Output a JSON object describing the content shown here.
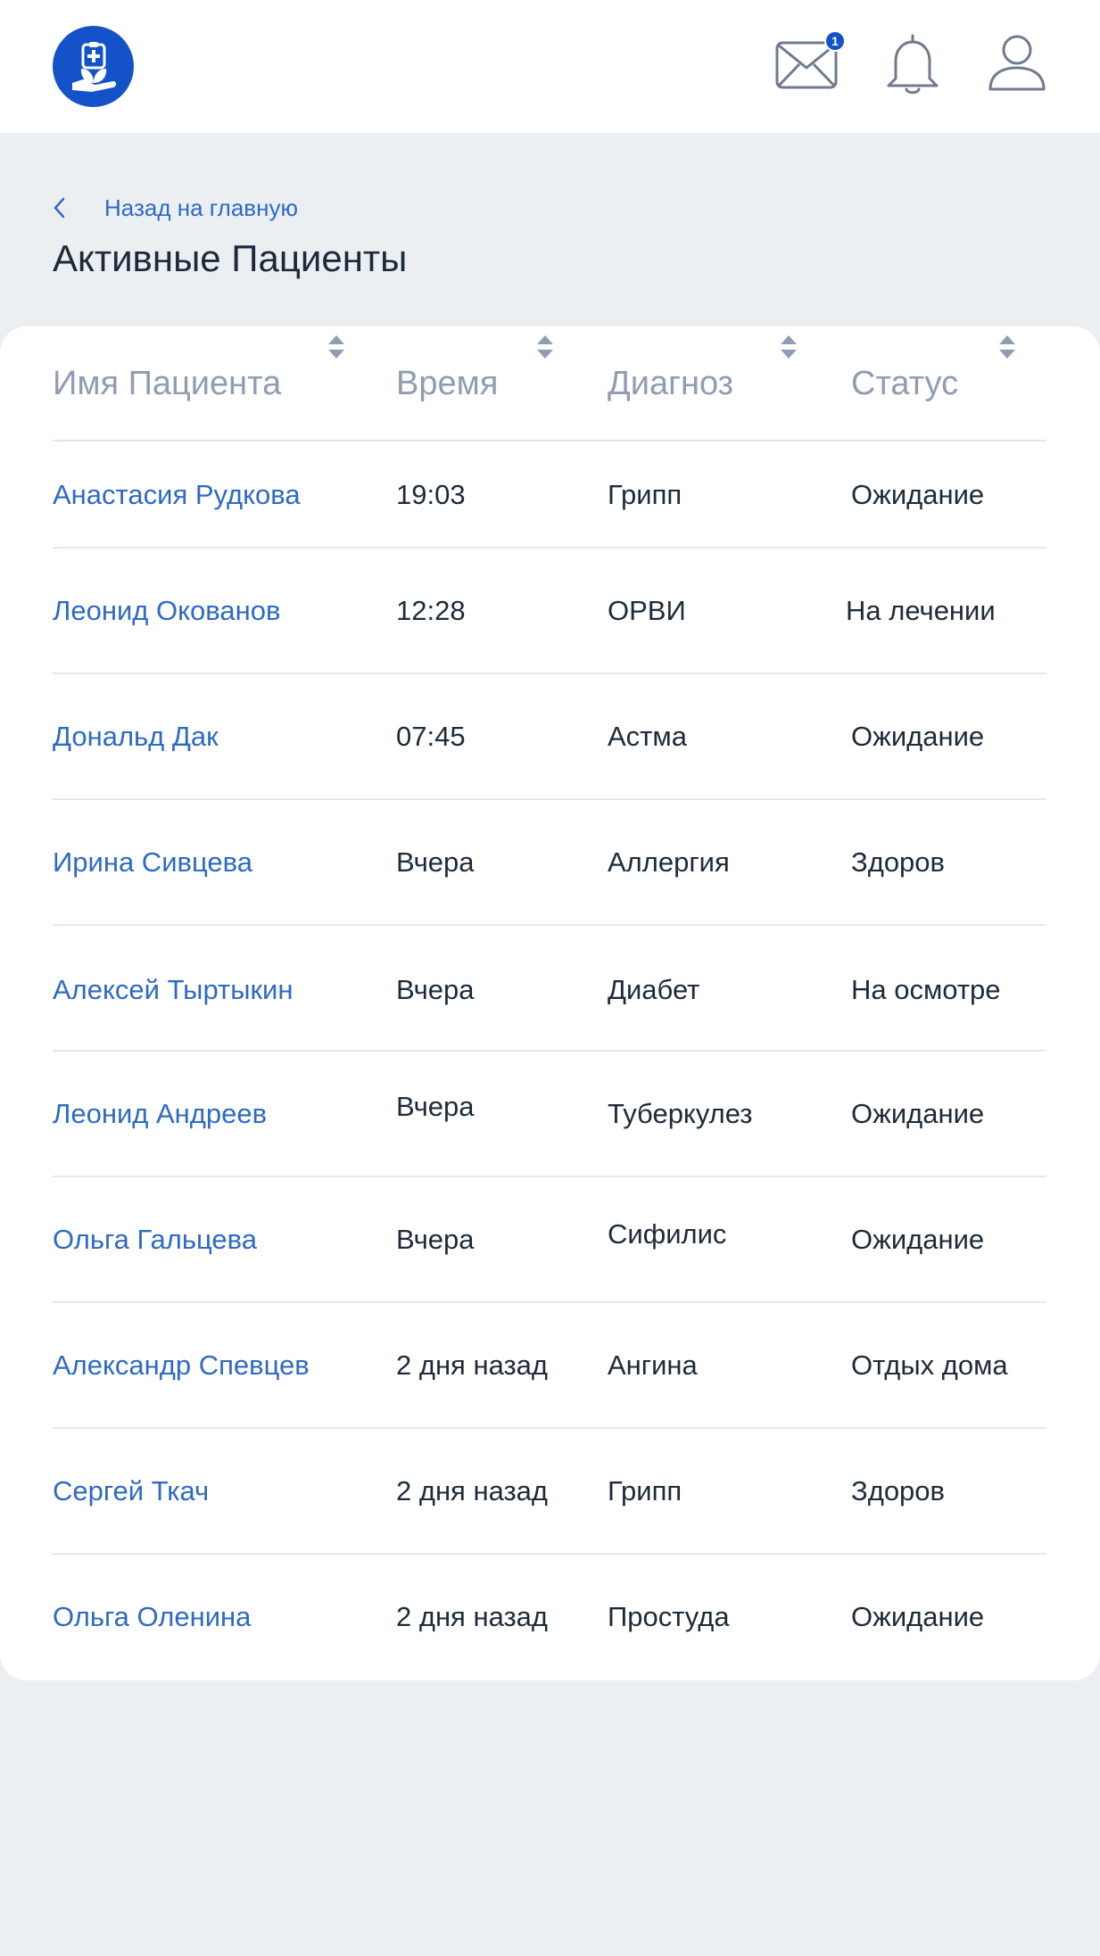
{
  "header": {
    "logo_icon": "medical-care-logo-icon",
    "mail_icon": "mail-icon",
    "mail_badge": "1",
    "bell_icon": "bell-icon",
    "user_icon": "user-icon",
    "brand_color": "#1352c9"
  },
  "nav": {
    "back_label": "Назад на главную",
    "back_icon": "chevron-left-icon"
  },
  "page": {
    "title": "Активные Пациенты"
  },
  "table": {
    "columns": [
      {
        "label": "Имя Пациента",
        "sort_icon": "sort-icon"
      },
      {
        "label": "Время",
        "sort_icon": "sort-icon"
      },
      {
        "label": "Диагноз",
        "sort_icon": "sort-icon"
      },
      {
        "label": "Статус",
        "sort_icon": "sort-icon"
      }
    ],
    "rows": [
      {
        "name": "Анастасия Рудкова",
        "time": "19:03",
        "diagnosis": "Грипп",
        "status": "Ожидание"
      },
      {
        "name": "Леонид Окованов",
        "time": "12:28",
        "diagnosis": "ОРВИ",
        "status": "На лечении"
      },
      {
        "name": "Дональд Дак",
        "time": "07:45",
        "diagnosis": "Астма",
        "status": "Ожидание"
      },
      {
        "name": "Ирина Сивцева",
        "time": "Вчера",
        "diagnosis": "Аллергия",
        "status": "Здоров"
      },
      {
        "name": "Алексей Тыртыкин",
        "time": "Вчера",
        "diagnosis": "Диабет",
        "status": "На осмотре"
      },
      {
        "name": "Леонид Андреев",
        "time": "Вчера",
        "diagnosis": "Туберкулез",
        "status": "Ожидание"
      },
      {
        "name": "Ольга Гальцева",
        "time": "Вчера",
        "diagnosis": "Сифилис",
        "status": "Ожидание"
      },
      {
        "name": "Александр Спевцев",
        "time": "2 дня назад",
        "diagnosis": "Ангина",
        "status": "Отдых дома"
      },
      {
        "name": "Сергей Ткач",
        "time": "2 дня назад",
        "diagnosis": "Грипп",
        "status": "Здоров"
      },
      {
        "name": "Ольга Оленина",
        "time": "2 дня назад",
        "diagnosis": "Простуда",
        "status": "Ожидание"
      }
    ]
  }
}
